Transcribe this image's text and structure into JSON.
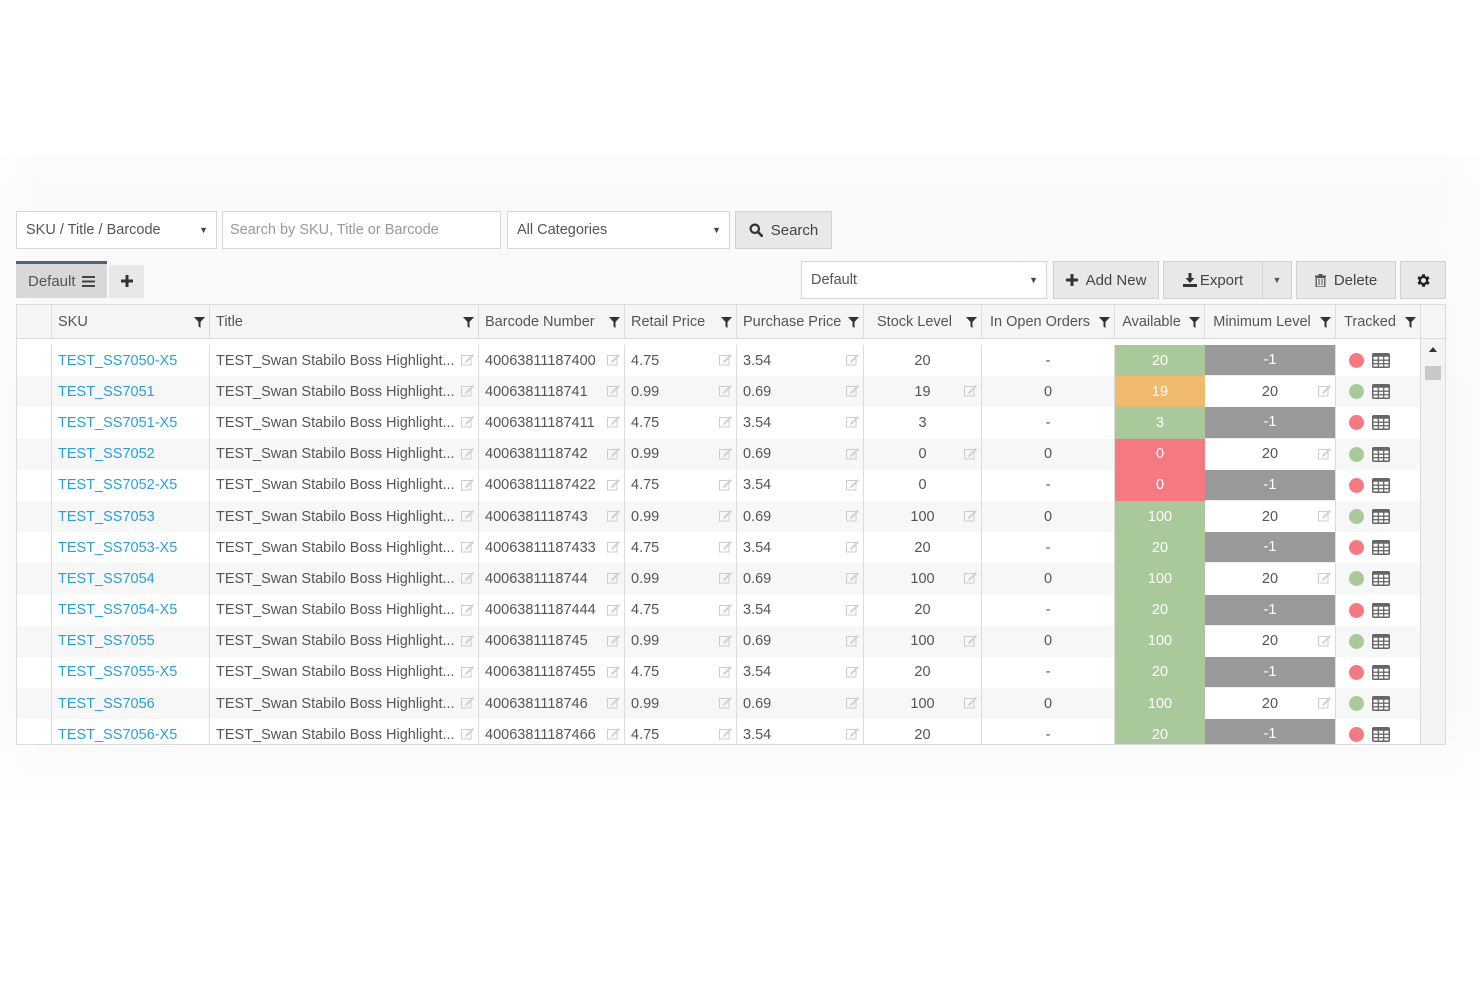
{
  "search": {
    "field_select": "SKU / Title / Barcode",
    "query_placeholder": "Search by SKU, Title or Barcode",
    "query_value": "",
    "category_select": "All Categories",
    "search_label": "Search"
  },
  "tabs": {
    "active": "Default",
    "add_label": "+"
  },
  "toolbar": {
    "view_select": "Default",
    "add_new_label": "Add New",
    "export_label": "Export",
    "delete_label": "Delete"
  },
  "columns": [
    {
      "key": "sku",
      "label": "SKU"
    },
    {
      "key": "title",
      "label": "Title"
    },
    {
      "key": "barcode",
      "label": "Barcode Number"
    },
    {
      "key": "retail",
      "label": "Retail Price"
    },
    {
      "key": "purchase",
      "label": "Purchase Price"
    },
    {
      "key": "stock",
      "label": "Stock Level"
    },
    {
      "key": "open",
      "label": "In Open Orders"
    },
    {
      "key": "available",
      "label": "Available"
    },
    {
      "key": "minimum",
      "label": "Minimum Level"
    },
    {
      "key": "tracked",
      "label": "Tracked"
    }
  ],
  "colors": {
    "link": "#2a9fd6",
    "available_green": "#a9c99b",
    "available_orange": "#efb96e",
    "available_red": "#f47983",
    "min_negative_bg": "#999999",
    "tracked_on": "#a9c99b",
    "tracked_off": "#f47983",
    "tab_accent": "#4f6478"
  },
  "rows": [
    {
      "sku": "TEST_SS7050-X5",
      "title": "TEST_Swan Stabilo Boss Highlight...",
      "barcode": "40063811187400",
      "retail": "4.75",
      "purchase": "3.54",
      "stock": "20",
      "stock_editable": false,
      "open": "-",
      "available": "20",
      "available_status": "green",
      "minimum": "-1",
      "tracked": false
    },
    {
      "sku": "TEST_SS7051",
      "title": "TEST_Swan Stabilo Boss Highlight...",
      "barcode": "4006381118741",
      "retail": "0.99",
      "purchase": "0.69",
      "stock": "19",
      "stock_editable": true,
      "open": "0",
      "available": "19",
      "available_status": "orange",
      "minimum": "20",
      "tracked": true
    },
    {
      "sku": "TEST_SS7051-X5",
      "title": "TEST_Swan Stabilo Boss Highlight...",
      "barcode": "40063811187411",
      "retail": "4.75",
      "purchase": "3.54",
      "stock": "3",
      "stock_editable": false,
      "open": "-",
      "available": "3",
      "available_status": "green",
      "minimum": "-1",
      "tracked": false
    },
    {
      "sku": "TEST_SS7052",
      "title": "TEST_Swan Stabilo Boss Highlight...",
      "barcode": "4006381118742",
      "retail": "0.99",
      "purchase": "0.69",
      "stock": "0",
      "stock_editable": true,
      "open": "0",
      "available": "0",
      "available_status": "red",
      "minimum": "20",
      "tracked": true
    },
    {
      "sku": "TEST_SS7052-X5",
      "title": "TEST_Swan Stabilo Boss Highlight...",
      "barcode": "40063811187422",
      "retail": "4.75",
      "purchase": "3.54",
      "stock": "0",
      "stock_editable": false,
      "open": "-",
      "available": "0",
      "available_status": "red",
      "minimum": "-1",
      "tracked": false
    },
    {
      "sku": "TEST_SS7053",
      "title": "TEST_Swan Stabilo Boss Highlight...",
      "barcode": "4006381118743",
      "retail": "0.99",
      "purchase": "0.69",
      "stock": "100",
      "stock_editable": true,
      "open": "0",
      "available": "100",
      "available_status": "green",
      "minimum": "20",
      "tracked": true
    },
    {
      "sku": "TEST_SS7053-X5",
      "title": "TEST_Swan Stabilo Boss Highlight...",
      "barcode": "40063811187433",
      "retail": "4.75",
      "purchase": "3.54",
      "stock": "20",
      "stock_editable": false,
      "open": "-",
      "available": "20",
      "available_status": "green",
      "minimum": "-1",
      "tracked": false
    },
    {
      "sku": "TEST_SS7054",
      "title": "TEST_Swan Stabilo Boss Highlight...",
      "barcode": "4006381118744",
      "retail": "0.99",
      "purchase": "0.69",
      "stock": "100",
      "stock_editable": true,
      "open": "0",
      "available": "100",
      "available_status": "green",
      "minimum": "20",
      "tracked": true
    },
    {
      "sku": "TEST_SS7054-X5",
      "title": "TEST_Swan Stabilo Boss Highlight...",
      "barcode": "40063811187444",
      "retail": "4.75",
      "purchase": "3.54",
      "stock": "20",
      "stock_editable": false,
      "open": "-",
      "available": "20",
      "available_status": "green",
      "minimum": "-1",
      "tracked": false
    },
    {
      "sku": "TEST_SS7055",
      "title": "TEST_Swan Stabilo Boss Highlight...",
      "barcode": "4006381118745",
      "retail": "0.99",
      "purchase": "0.69",
      "stock": "100",
      "stock_editable": true,
      "open": "0",
      "available": "100",
      "available_status": "green",
      "minimum": "20",
      "tracked": true
    },
    {
      "sku": "TEST_SS7055-X5",
      "title": "TEST_Swan Stabilo Boss Highlight...",
      "barcode": "40063811187455",
      "retail": "4.75",
      "purchase": "3.54",
      "stock": "20",
      "stock_editable": false,
      "open": "-",
      "available": "20",
      "available_status": "green",
      "minimum": "-1",
      "tracked": false
    },
    {
      "sku": "TEST_SS7056",
      "title": "TEST_Swan Stabilo Boss Highlight...",
      "barcode": "4006381118746",
      "retail": "0.99",
      "purchase": "0.69",
      "stock": "100",
      "stock_editable": true,
      "open": "0",
      "available": "100",
      "available_status": "green",
      "minimum": "20",
      "tracked": true
    },
    {
      "sku": "TEST_SS7056-X5",
      "title": "TEST_Swan Stabilo Boss Highlight...",
      "barcode": "40063811187466",
      "retail": "4.75",
      "purchase": "3.54",
      "stock": "20",
      "stock_editable": false,
      "open": "-",
      "available": "20",
      "available_status": "green",
      "minimum": "-1",
      "tracked": false
    }
  ]
}
